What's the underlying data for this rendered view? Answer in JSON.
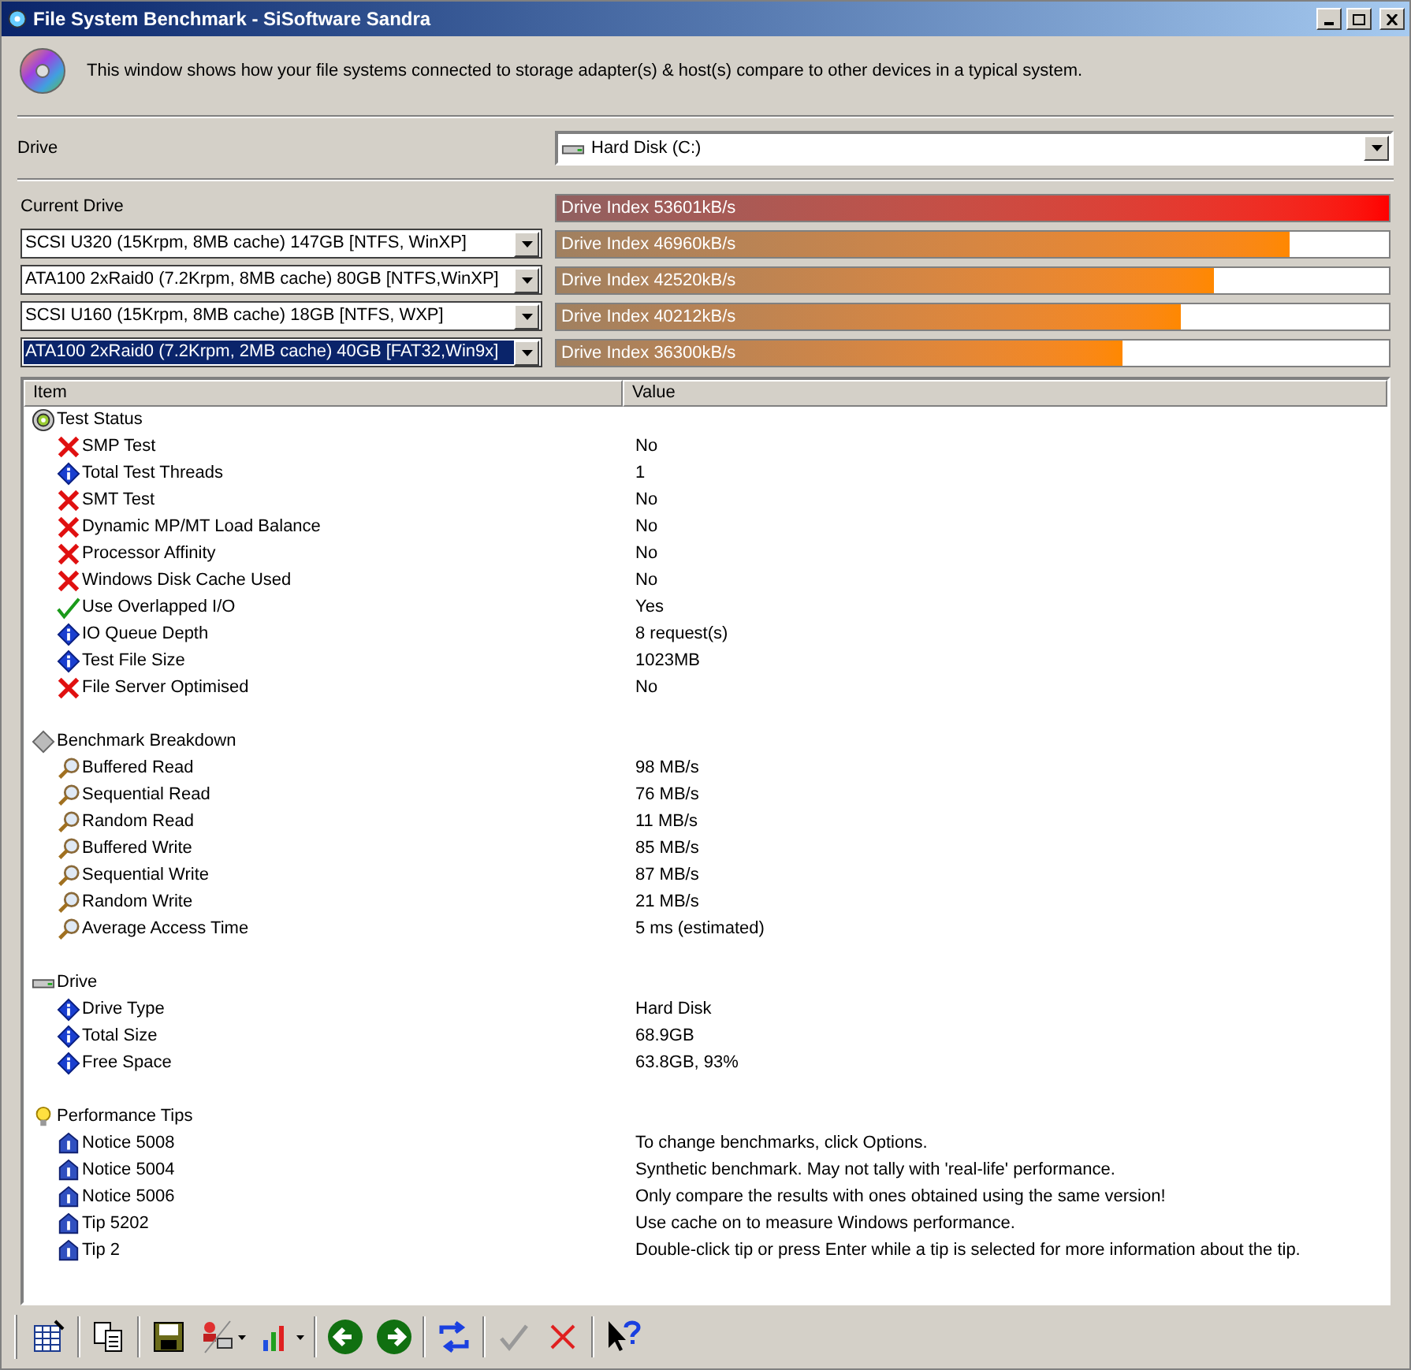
{
  "window": {
    "title": "File System Benchmark - SiSoftware Sandra"
  },
  "intro": "This window shows how your file systems connected to storage adapter(s) & host(s) compare to other devices in a typical system.",
  "drive": {
    "label": "Drive",
    "value": "Hard Disk (C:)"
  },
  "current": {
    "label": "Current Drive",
    "bar_text": "Drive Index 53601kB/s",
    "level": 1
  },
  "comparisons": [
    {
      "device": "SCSI U320 (15Krpm, 8MB cache) 147GB [NTFS, WinXP]",
      "selected": false,
      "bar_text": "Drive Index 46960kB/s",
      "level": 0.88
    },
    {
      "device": "ATA100 2xRaid0 (7.2Krpm, 8MB cache) 80GB [NTFS,WinXP]",
      "selected": false,
      "bar_text": "Drive Index 42520kB/s",
      "level": 0.79
    },
    {
      "device": "SCSI U160 (15Krpm, 8MB cache) 18GB [NTFS, WXP]",
      "selected": false,
      "bar_text": "Drive Index 40212kB/s",
      "level": 0.75
    },
    {
      "device": "ATA100 2xRaid0 (7.2Krpm, 2MB cache) 40GB [FAT32,Win9x]",
      "selected": true,
      "bar_text": "Drive Index 36300kB/s",
      "level": 0.68
    }
  ],
  "table": {
    "columns": [
      "Item",
      "Value"
    ],
    "groups": [
      {
        "kind": "disc",
        "title": "Test Status",
        "rows": [
          {
            "kind": "cross",
            "item": "SMP Test",
            "value": "No"
          },
          {
            "kind": "info",
            "item": "Total Test Threads",
            "value": "1"
          },
          {
            "kind": "cross",
            "item": "SMT Test",
            "value": "No"
          },
          {
            "kind": "cross",
            "item": "Dynamic MP/MT Load Balance",
            "value": "No"
          },
          {
            "kind": "cross",
            "item": "Processor Affinity",
            "value": "No"
          },
          {
            "kind": "cross",
            "item": "Windows Disk Cache Used",
            "value": "No"
          },
          {
            "kind": "check",
            "item": "Use Overlapped I/O",
            "value": "Yes"
          },
          {
            "kind": "info",
            "item": "IO Queue Depth",
            "value": "8 request(s)"
          },
          {
            "kind": "info",
            "item": "Test File Size",
            "value": "1023MB"
          },
          {
            "kind": "cross",
            "item": "File Server Optimised",
            "value": "No"
          }
        ]
      },
      {
        "kind": "diamond",
        "title": "Benchmark Breakdown",
        "rows": [
          {
            "kind": "magnifier",
            "item": "Buffered Read",
            "value": "98 MB/s"
          },
          {
            "kind": "magnifier",
            "item": "Sequential Read",
            "value": "76 MB/s"
          },
          {
            "kind": "magnifier",
            "item": "Random Read",
            "value": "11 MB/s"
          },
          {
            "kind": "magnifier",
            "item": "Buffered Write",
            "value": "85 MB/s"
          },
          {
            "kind": "magnifier",
            "item": "Sequential Write",
            "value": "87 MB/s"
          },
          {
            "kind": "magnifier",
            "item": "Random Write",
            "value": "21 MB/s"
          },
          {
            "kind": "magnifier",
            "item": "Average Access Time",
            "value": "5 ms (estimated)"
          }
        ]
      },
      {
        "kind": "drive",
        "title": "Drive",
        "rows": [
          {
            "kind": "info",
            "item": "Drive Type",
            "value": "Hard Disk"
          },
          {
            "kind": "info",
            "item": "Total Size",
            "value": "68.9GB"
          },
          {
            "kind": "info",
            "item": "Free Space",
            "value": "63.8GB, 93%"
          }
        ]
      },
      {
        "kind": "bulb",
        "title": "Performance Tips",
        "rows": [
          {
            "kind": "notice",
            "item": "Notice 5008",
            "value": "To change benchmarks, click Options."
          },
          {
            "kind": "notice",
            "item": "Notice 5004",
            "value": "Synthetic benchmark. May not tally with 'real-life' performance."
          },
          {
            "kind": "notice",
            "item": "Notice 5006",
            "value": "Only compare the results with ones obtained using the same version!"
          },
          {
            "kind": "notice",
            "item": "Tip 5202",
            "value": "Use cache on to measure Windows performance."
          },
          {
            "kind": "notice",
            "item": "Tip 2",
            "value": "Double-click tip or press Enter while a tip is selected for more information about the tip."
          }
        ]
      }
    ]
  }
}
